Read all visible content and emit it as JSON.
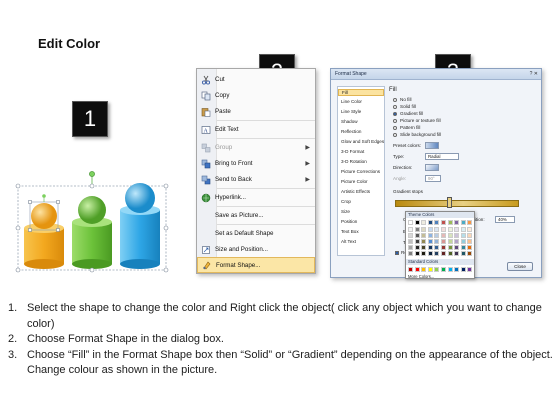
{
  "slide": {
    "title": "Edit Color"
  },
  "badges": [
    "1",
    "2",
    "3"
  ],
  "context_menu": {
    "items": [
      {
        "label": "Cut",
        "icon": "scissors-icon",
        "enabled": true,
        "submenu": false
      },
      {
        "label": "Copy",
        "icon": "copy-icon",
        "enabled": true,
        "submenu": false
      },
      {
        "label": "Paste",
        "icon": "paste-icon",
        "enabled": true,
        "submenu": false
      },
      {
        "label": "Edit Text",
        "icon": "edit-text-icon",
        "enabled": true,
        "submenu": false
      },
      {
        "label": "Group",
        "icon": "group-icon",
        "enabled": false,
        "submenu": true
      },
      {
        "label": "Bring to Front",
        "icon": "bring-front-icon",
        "enabled": true,
        "submenu": true
      },
      {
        "label": "Send to Back",
        "icon": "send-back-icon",
        "enabled": true,
        "submenu": true
      },
      {
        "label": "Hyperlink...",
        "icon": "hyperlink-icon",
        "enabled": true,
        "submenu": false
      },
      {
        "label": "Save as Picture...",
        "icon": "",
        "enabled": true,
        "submenu": false
      },
      {
        "label": "Set as Default Shape",
        "icon": "",
        "enabled": true,
        "submenu": false
      },
      {
        "label": "Size and Position...",
        "icon": "size-position-icon",
        "enabled": true,
        "submenu": false
      },
      {
        "label": "Format Shape...",
        "icon": "format-shape-icon",
        "enabled": true,
        "submenu": false,
        "highlighted": true
      }
    ]
  },
  "format_dialog": {
    "title": "Format Shape",
    "controls": "? ✕",
    "nav": [
      "Fill",
      "Line Color",
      "Line Style",
      "Shadow",
      "Reflection",
      "Glow and Soft Edges",
      "3-D Format",
      "3-D Rotation",
      "Picture Corrections",
      "Picture Color",
      "Artistic Effects",
      "Crop",
      "Size",
      "Position",
      "Text Box",
      "Alt Text"
    ],
    "panel": {
      "heading": "Fill",
      "options": [
        "No fill",
        "Solid fill",
        "Gradient fill",
        "Picture or texture fill",
        "Pattern fill",
        "Slide background fill"
      ],
      "selected_option": "Gradient fill",
      "preset_colors_label": "Preset colors:",
      "type_label": "Type:",
      "type_value": "Radial",
      "direction_label": "Direction:",
      "angle_label": "Angle:",
      "angle_value": "90°",
      "gradient_stops_label": "Gradient stops",
      "color_label": "Color",
      "position_label": "Position:",
      "position_value": "40%",
      "brightness_label": "Brightness",
      "transparency_label": "Transparency",
      "rotate_label": "Rotate with shape",
      "theme_colors_label": "Theme Colors",
      "standard_colors_label": "Standard Colors",
      "more_colors_label": "More Colors..."
    },
    "close_label": "Close"
  },
  "colors": {
    "theme_rows": [
      [
        "#ffffff",
        "#000000",
        "#eeece1",
        "#1f497d",
        "#4f81bd",
        "#c0504d",
        "#9bbb59",
        "#8064a2",
        "#4bacc6",
        "#f79646"
      ],
      [
        "#f2f2f2",
        "#7f7f7f",
        "#ddd9c3",
        "#c6d9f0",
        "#dbe5f1",
        "#f2dcdb",
        "#ebf1dd",
        "#e5e0ec",
        "#dbeef3",
        "#fdeada"
      ],
      [
        "#d8d8d8",
        "#595959",
        "#c4bd97",
        "#8db3e2",
        "#b8cce4",
        "#e5b9b7",
        "#d7e3bc",
        "#ccc1d9",
        "#b7dde8",
        "#fbd5b5"
      ],
      [
        "#bfbfbf",
        "#3f3f3f",
        "#938953",
        "#548dd4",
        "#95b3d7",
        "#d99694",
        "#c3d69b",
        "#b2a2c7",
        "#92cddc",
        "#fac08f"
      ],
      [
        "#a5a5a5",
        "#262626",
        "#494429",
        "#17365d",
        "#366092",
        "#953734",
        "#76923c",
        "#5f497a",
        "#31859b",
        "#e36c09"
      ],
      [
        "#7f7f7f",
        "#0c0c0c",
        "#1d1b10",
        "#0f243e",
        "#244061",
        "#632423",
        "#4f6128",
        "#3f3151",
        "#205867",
        "#974806"
      ]
    ],
    "standard": [
      "#c00000",
      "#ff0000",
      "#ffc000",
      "#ffff00",
      "#92d050",
      "#00b050",
      "#00b0f0",
      "#0070c0",
      "#002060",
      "#7030a0"
    ],
    "shapes": {
      "orange": "#f3a81f",
      "green": "#6cc23a",
      "blue": "#2ea6e6"
    }
  },
  "instructions": [
    {
      "num": "1.",
      "text": "Select the shape to change the color and Right click the object( click any object which you want to change color)"
    },
    {
      "num": "2.",
      "text": "Choose Format Shape in the dialog box."
    },
    {
      "num": "3.",
      "text": "Choose “Fill” in the Format Shape box then “Solid” or “Gradient” depending on the appearance of the object. Change colour as shown in the picture."
    }
  ]
}
